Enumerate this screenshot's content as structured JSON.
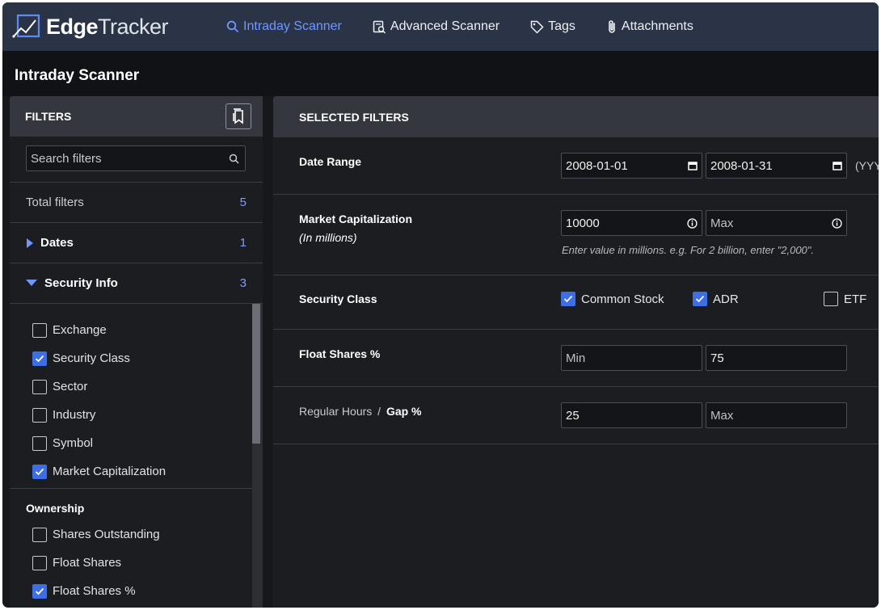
{
  "app": {
    "logo_bold": "Edge",
    "logo_light": "Tracker",
    "accent_color": "#6f97ff",
    "check_color": "#3e6ee6"
  },
  "nav": {
    "items": [
      {
        "label": "Intraday Scanner",
        "icon": "search-icon",
        "active": true
      },
      {
        "label": "Advanced Scanner",
        "icon": "advanced-search-icon",
        "active": false
      },
      {
        "label": "Tags",
        "icon": "tag-icon",
        "active": false
      },
      {
        "label": "Attachments",
        "icon": "paperclip-icon",
        "active": false
      }
    ]
  },
  "page": {
    "title": "Intraday Scanner"
  },
  "filters_panel": {
    "title": "FILTERS",
    "bookmark_icon": "bookmark-icon",
    "search_placeholder": "Search filters",
    "total_label": "Total filters",
    "total_count": "5",
    "sections": [
      {
        "label": "Dates",
        "count": "1",
        "expanded": false
      },
      {
        "label": "Security Info",
        "count": "3",
        "expanded": true
      }
    ],
    "security_info_items": [
      {
        "label": "Exchange",
        "checked": false
      },
      {
        "label": "Security Class",
        "checked": true
      },
      {
        "label": "Sector",
        "checked": false
      },
      {
        "label": "Industry",
        "checked": false
      },
      {
        "label": "Symbol",
        "checked": false
      },
      {
        "label": "Market Capitalization",
        "checked": true
      }
    ],
    "ownership_title": "Ownership",
    "ownership_items": [
      {
        "label": "Shares Outstanding",
        "checked": false
      },
      {
        "label": "Float Shares",
        "checked": false
      },
      {
        "label": "Float Shares %",
        "checked": true
      }
    ]
  },
  "selected_panel": {
    "title": "SELECTED FILTERS",
    "date_range": {
      "label": "Date Range",
      "start": "2008-01-01",
      "end": "2008-01-31",
      "format_hint": "(YYY"
    },
    "market_cap": {
      "label": "Market Capitalization",
      "sublabel": "(In millions)",
      "min": "10000",
      "max_placeholder": "Max",
      "hint": "Enter value in millions. e.g. For 2 billion, enter \"2,000\"."
    },
    "security_class": {
      "label": "Security Class",
      "options": [
        {
          "label": "Common Stock",
          "checked": true
        },
        {
          "label": "ADR",
          "checked": true
        },
        {
          "label": "ETF",
          "checked": false
        }
      ]
    },
    "float_pct": {
      "label": "Float Shares %",
      "min_placeholder": "Min",
      "max": "75"
    },
    "gap": {
      "label_prefix": "Regular Hours",
      "separator": "/",
      "label": "Gap %",
      "min": "25",
      "max_placeholder": "Max"
    }
  }
}
